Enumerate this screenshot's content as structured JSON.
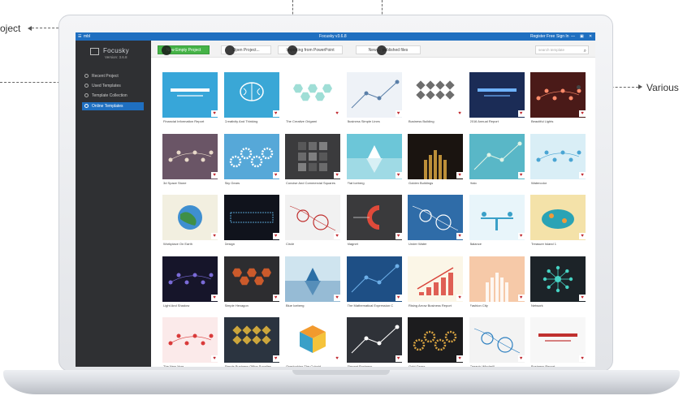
{
  "callouts": {
    "left_top": "oject",
    "right": "Various"
  },
  "app": {
    "menu_label": "mbl",
    "window_title": "Focusky v3.6.8",
    "register": "Register Free",
    "signin": "Sign In",
    "controls": [
      "—",
      "▣",
      "✕"
    ]
  },
  "sidebar": {
    "logo_name": "Focusky",
    "version": "Version: 3.6.8",
    "items": [
      {
        "label": "Recent Project",
        "icon": "clock-icon"
      },
      {
        "label": "Used Templates",
        "icon": "doc-icon"
      },
      {
        "label": "Template Collection",
        "icon": "star-icon"
      },
      {
        "label": "Online Templates",
        "icon": "cloud-icon",
        "active": true
      }
    ]
  },
  "toolbar": {
    "new_project": "New Empty Project",
    "open_project": "Open Project...",
    "import_ppt": "Importing from PowerPoint",
    "new_published": "New ... published files",
    "search_placeholder": "search template"
  },
  "colors": {
    "accent": "#1f6fc0",
    "sidebar": "#2f3033",
    "green": "#45b347",
    "heart": "#c0262d"
  },
  "templates": [
    {
      "name": "Financial Information Report",
      "bg": "#37a6d9",
      "fg": "#ffffff",
      "motif": "text"
    },
    {
      "name": "Creativity And Thinking",
      "bg": "#3aa7d6",
      "fg": "#ffffff",
      "motif": "brain"
    },
    {
      "name": "The Creative Origami",
      "bg": "#ffffff",
      "fg": "#7fd3c8",
      "motif": "hexes"
    },
    {
      "name": "Business Simple Lines",
      "bg": "#eef2f7",
      "fg": "#5a7fa8",
      "motif": "lines"
    },
    {
      "name": "Business Building",
      "bg": "#ffffff",
      "fg": "#4a4a4a",
      "motif": "diamonds"
    },
    {
      "name": "2016 Annual Report",
      "bg": "#1b2c56",
      "fg": "#6fb3ff",
      "motif": "text"
    },
    {
      "name": "Beautiful Lights",
      "bg": "#4a1a18",
      "fg": "#ff8b6a",
      "motif": "dots"
    },
    {
      "name": "3d Space Stone",
      "bg": "#6a5566",
      "fg": "#e8d9c9",
      "motif": "dots"
    },
    {
      "name": "Sky Gears",
      "bg": "#56a8d8",
      "fg": "#ffffff",
      "motif": "gears"
    },
    {
      "name": "Concise And Commercial Squares",
      "bg": "#3b3b3d",
      "fg": "#9c9c9c",
      "motif": "squares"
    },
    {
      "name": "Flat Iceberg",
      "bg": "#6cc6d8",
      "fg": "#ffffff",
      "motif": "iceberg"
    },
    {
      "name": "Golden Buildings",
      "bg": "#1a1410",
      "fg": "#d9a441",
      "motif": "tower"
    },
    {
      "name": "Halo",
      "bg": "#59b7c7",
      "fg": "#dff3e6",
      "motif": "lines"
    },
    {
      "name": "Watercolor",
      "bg": "#d9eef6",
      "fg": "#4aa5d3",
      "motif": "dots"
    },
    {
      "name": "Workplace On Earth",
      "bg": "#f2efe0",
      "fg": "#3f8f46",
      "motif": "globe"
    },
    {
      "name": "Design",
      "bg": "#10131c",
      "fg": "#6ac9ff",
      "motif": "design"
    },
    {
      "name": "Circle",
      "bg": "#f1f1f1",
      "fg": "#c0302f",
      "motif": "circles"
    },
    {
      "name": "Magnet",
      "bg": "#3a3a3c",
      "fg": "#e04a3a",
      "motif": "magnet"
    },
    {
      "name": "Under Water",
      "bg": "#2f6ca8",
      "fg": "#ffffff",
      "motif": "circles"
    },
    {
      "name": "Balance",
      "bg": "#e8f5fa",
      "fg": "#3aa0c8",
      "motif": "balance"
    },
    {
      "name": "Treasure Island 1",
      "bg": "#f4e2a9",
      "fg": "#2aa3b5",
      "motif": "island"
    },
    {
      "name": "Light And Shadow",
      "bg": "#16152a",
      "fg": "#7a6bd8",
      "motif": "dots"
    },
    {
      "name": "Simple Hexagon",
      "bg": "#2d2d30",
      "fg": "#ff6a2a",
      "motif": "hexes"
    },
    {
      "name": "Blue Iceberg",
      "bg": "#cfe4ef",
      "fg": "#2b6fa6",
      "motif": "iceberg"
    },
    {
      "name": "The Mathematical Expression C",
      "bg": "#1e4f85",
      "fg": "#6dafe8",
      "motif": "lines"
    },
    {
      "name": "Rising Arrow Business Report",
      "bg": "#fbf6e7",
      "fg": "#d9443a",
      "motif": "bars"
    },
    {
      "name": "Fashion City",
      "bg": "#f6c9a8",
      "fg": "#ffffff",
      "motif": "tower"
    },
    {
      "name": "Network",
      "bg": "#1c2328",
      "fg": "#46d3c4",
      "motif": "network"
    },
    {
      "name": "The New Year",
      "bg": "#fbeaea",
      "fg": "#d93a3a",
      "motif": "dots"
    },
    {
      "name": "Simple Business Office Supplies",
      "bg": "#2b3440",
      "fg": "#f5c33b",
      "motif": "diamonds"
    },
    {
      "name": "Overlooking The Cuboid",
      "bg": "#ffffff",
      "fg": "#f29a2e",
      "motif": "cube"
    },
    {
      "name": "Elegant Business",
      "bg": "#2f3238",
      "fg": "#ffffff",
      "motif": "lines"
    },
    {
      "name": "Gold Gears",
      "bg": "#1c1c1e",
      "fg": "#d9a441",
      "motif": "gears"
    },
    {
      "name": "Organic Windmill",
      "bg": "#f3f3f3",
      "fg": "#2c7fc0",
      "motif": "circles"
    },
    {
      "name": "Business Report",
      "bg": "#f7f7f7",
      "fg": "#c0302f",
      "motif": "text"
    }
  ]
}
